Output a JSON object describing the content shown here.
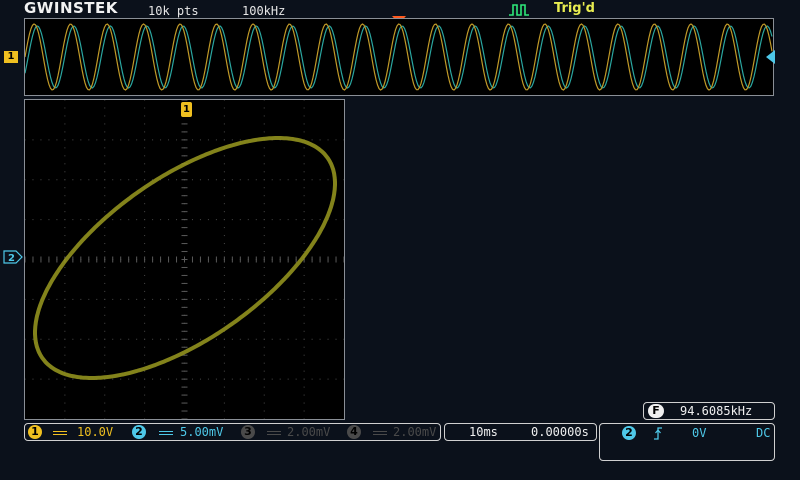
{
  "header": {
    "brand": "GWINSTEK",
    "record_length": "10k pts",
    "sample_rate": "100kHz",
    "trigger_status": "Trig'd"
  },
  "markers": {
    "ch1": "1",
    "ch2": "2"
  },
  "measurement": {
    "badge": "F",
    "frequency": "94.6085kHz"
  },
  "channels": [
    {
      "id": "1",
      "scale": "10.0V",
      "color": "#f0c020",
      "active": true
    },
    {
      "id": "2",
      "scale": "5.00mV",
      "color": "#4ec8e8",
      "active": true
    },
    {
      "id": "3",
      "scale": "2.00mV",
      "color": "#4a4a4a",
      "active": false
    },
    {
      "id": "4",
      "scale": "2.00mV",
      "color": "#4a4a4a",
      "active": false
    }
  ],
  "timebase": {
    "time_div": "10ms",
    "position": "0.00000s"
  },
  "trigger": {
    "source": "2",
    "slope_icon": "rising-edge-icon",
    "level": "0V",
    "coupling": "DC"
  },
  "colors": {
    "ch1": "#f0c020",
    "ch2": "#4ec8e8",
    "xy_trace": "#9a9a20",
    "trigger_marker": "#ff5a1f"
  }
}
